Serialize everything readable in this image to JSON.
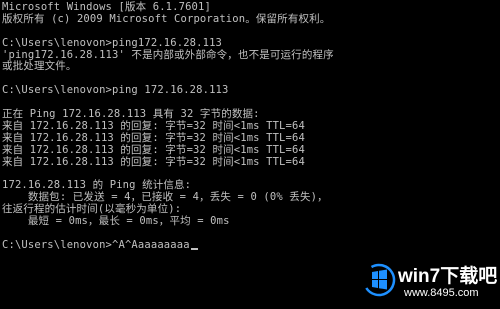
{
  "console": {
    "lines": [
      "Microsoft Windows [版本 6.1.7601]",
      "版权所有 (c) 2009 Microsoft Corporation。保留所有权利。",
      "",
      "C:\\Users\\lenovon>ping172.16.28.113",
      "'ping172.16.28.113' 不是内部或外部命令，也不是可运行的程序",
      "或批处理文件。",
      "",
      "C:\\Users\\lenovon>ping 172.16.28.113",
      "",
      "正在 Ping 172.16.28.113 具有 32 字节的数据:",
      "来自 172.16.28.113 的回复: 字节=32 时间<1ms TTL=64",
      "来自 172.16.28.113 的回复: 字节=32 时间<1ms TTL=64",
      "来自 172.16.28.113 的回复: 字节=32 时间<1ms TTL=64",
      "来自 172.16.28.113 的回复: 字节=32 时间<1ms TTL=64",
      "",
      "172.16.28.113 的 Ping 统计信息:",
      "    数据包: 已发送 = 4，已接收 = 4，丢失 = 0 (0% 丢失)，",
      "往返行程的估计时间(以毫秒为单位):",
      "    最短 = 0ms，最长 = 0ms，平均 = 0ms",
      "",
      "C:\\Users\\lenovon>^A^Aaaaaaaaa"
    ]
  },
  "watermark": {
    "brand": "win7下载吧",
    "url": "www.8495.com",
    "logo_icon": "windows-flag-icon",
    "colors": {
      "logo_blue": "#1e90ff",
      "text": "#ffffff"
    }
  }
}
